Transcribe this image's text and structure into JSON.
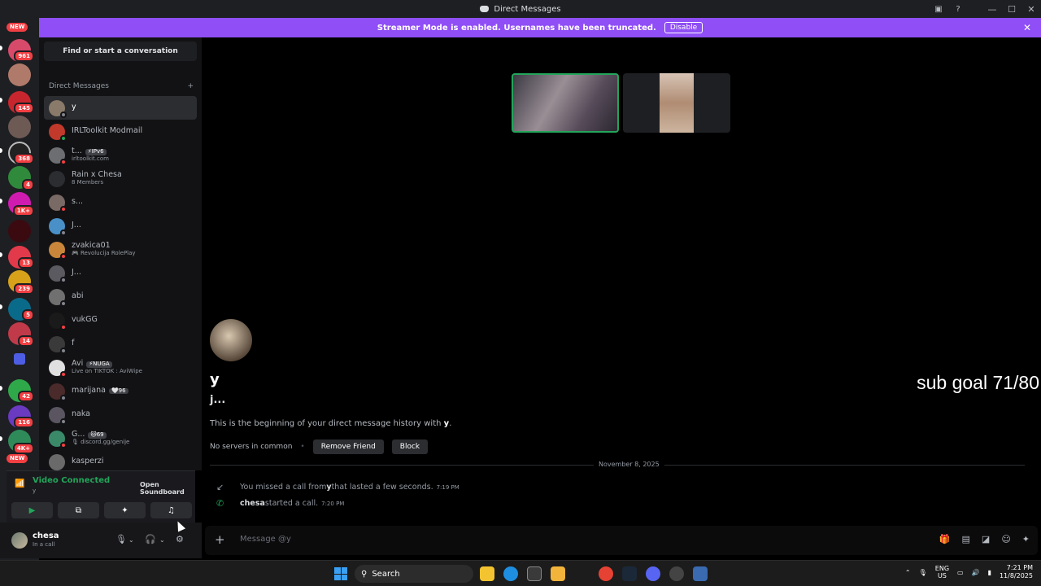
{
  "window": {
    "title": "Direct Messages"
  },
  "banner": {
    "text": "Streamer Mode is enabled. Usernames have been truncated.",
    "disable_label": "Disable"
  },
  "rail": {
    "badges": [
      "961",
      "145",
      "368",
      "4",
      "1K+",
      "13",
      "239",
      "5",
      "14",
      "42",
      "116",
      "4K+"
    ],
    "new_labels": [
      "NEW",
      "NEW"
    ]
  },
  "sidebar": {
    "search_label": "Find or start a conversation",
    "dm_header": "Direct Messages",
    "add_icon": "+",
    "dms": [
      {
        "name": "y",
        "sub": "",
        "tag": "",
        "status": "offline"
      },
      {
        "name": "IRLToolkit Modmail",
        "sub": "",
        "tag": "",
        "status": "online"
      },
      {
        "name": "t...",
        "sub": "irltoolkit.com",
        "tag": "⚡IPv6",
        "status": "dnd"
      },
      {
        "name": "Rain x Chesa",
        "sub": "8 Members",
        "tag": "",
        "status": ""
      },
      {
        "name": "s...",
        "sub": "",
        "tag": "",
        "status": "dnd"
      },
      {
        "name": "J...",
        "sub": "",
        "tag": "",
        "status": "offline"
      },
      {
        "name": "zvakica01",
        "sub": "🎮 Revolucija RolePlay",
        "tag": "",
        "status": "dnd"
      },
      {
        "name": "J...",
        "sub": "",
        "tag": "",
        "status": "offline"
      },
      {
        "name": "abi",
        "sub": "",
        "tag": "",
        "status": "offline"
      },
      {
        "name": "vukGG",
        "sub": "",
        "tag": "",
        "status": "dnd"
      },
      {
        "name": "f",
        "sub": "",
        "tag": "",
        "status": "offline"
      },
      {
        "name": "Avi",
        "sub": "Live on TIKTOK : AviWipe",
        "tag": "⚡NUGA",
        "status": "dnd"
      },
      {
        "name": "marijana",
        "sub": "",
        "tag": "🤍96",
        "status": "offline"
      },
      {
        "name": "naka",
        "sub": "",
        "tag": "",
        "status": "offline"
      },
      {
        "name": "G...",
        "sub": "🎙 discord.gg/genije",
        "tag": "🐱69",
        "status": "dnd"
      },
      {
        "name": "kasperzi",
        "sub": "",
        "tag": "",
        "status": ""
      }
    ]
  },
  "voice": {
    "title": "Video Connected",
    "sub": "y",
    "tooltip": "Open Soundboard"
  },
  "user": {
    "name": "chesa",
    "status": "In a call"
  },
  "chat": {
    "title": "y",
    "handle": "j...",
    "intro_prefix": "This is the beginning of your direct message history with ",
    "intro_name": "y",
    "intro_suffix": ".",
    "servers": "No servers in common",
    "remove_friend": "Remove Friend",
    "block": "Block",
    "date": "November 8, 2025",
    "missed_prefix": "You missed a call from ",
    "missed_name": "y",
    "missed_suffix": " that lasted a few seconds.",
    "missed_time": "7:19 PM",
    "started_name": "chesa",
    "started_text": " started a call.",
    "started_time": "7:20 PM",
    "placeholder": "Message @y"
  },
  "overlay": {
    "sub_goal": "sub goal 71/80"
  },
  "taskbar": {
    "search": "Search",
    "lang_top": "ENG",
    "lang_bottom": "US",
    "time": "7:21 PM",
    "date": "11/8/2025"
  },
  "colors": {
    "banner": "#8f4ef6",
    "online": "#23a55a",
    "dnd": "#f23f43",
    "offline": "#80848e"
  }
}
